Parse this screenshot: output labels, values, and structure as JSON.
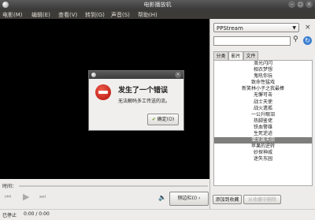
{
  "window": {
    "title": "电影播放机"
  },
  "menu": [
    "电影(M)",
    "编辑(E)",
    "查看(V)",
    "转到(G)",
    "声音(S)",
    "帮助(H)"
  ],
  "dialog": {
    "heading": "发生了一个错误",
    "message": "无法解码多工传送的流。",
    "ok_label": "确定(O)"
  },
  "controls": {
    "time_label": "时间：",
    "sidebar_button": "侧边栏(I) ‹"
  },
  "status": {
    "state": "已停止",
    "position": "0:00 / 0:00"
  },
  "panel": {
    "source": "PPStream",
    "tabs": [
      "分类",
      "影片",
      "文件"
    ],
    "active_tab": "影片",
    "items": [
      "滑光闪闪",
      "相衣梦想",
      "鬼吼你玩",
      "致命性猛戏",
      "新笑林小子之我最棒",
      "无懈可击",
      "战士天使",
      "战火遗孤",
      "一公升眼泪",
      "热脚鉴佬",
      "铁血警雄",
      "生死逆迹",
      "潜龙轰天旧",
      "苹果的逆转",
      "妙探神戚",
      "迷失东园"
    ],
    "selected_index": 12,
    "add_favorite": "添加到收藏",
    "remove_favorite": "从收藏中删除"
  }
}
